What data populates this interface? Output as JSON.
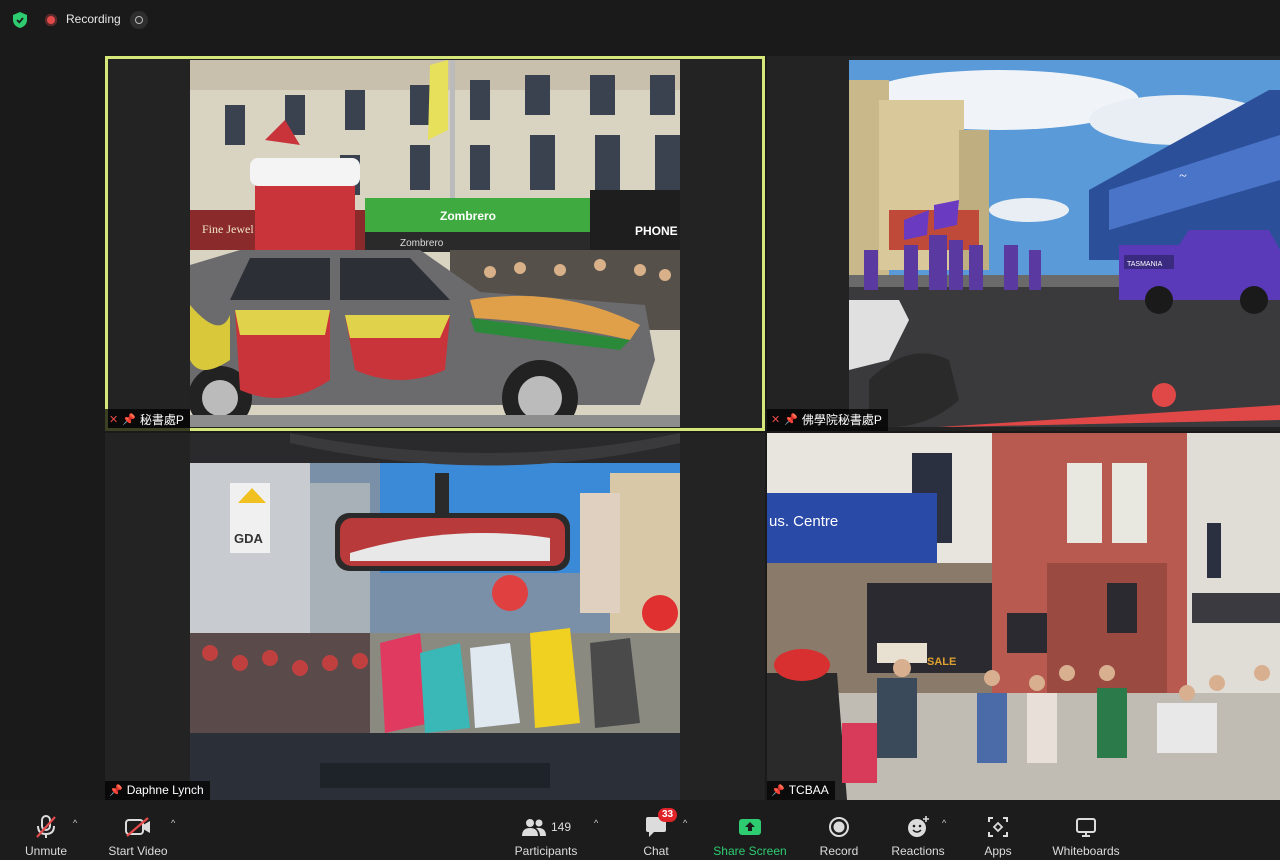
{
  "app": {
    "recording_label": "Recording",
    "accent_color": "#d6e77a",
    "icons": [
      "shield-icon",
      "record-dot-icon",
      "record-control-icon"
    ]
  },
  "tiles": [
    {
      "name": "秘書處P",
      "muted": true,
      "pinned": true,
      "active": true
    },
    {
      "name": "佛學院秘書處P",
      "muted": true,
      "pinned": true,
      "active": false
    },
    {
      "name": "Daphne Lynch",
      "muted": false,
      "pinned": true,
      "active": false
    },
    {
      "name": "TCBAA",
      "muted": false,
      "pinned": true,
      "active": false
    }
  ],
  "video_text": {
    "shop1": "Zombrero",
    "shop2": "Zombrero",
    "shop3": "PHONE",
    "shop4": "Fine Jewel",
    "store1": "GDA",
    "centre": "us. Centre",
    "sale": "SALE",
    "truck": "TASMANIA"
  },
  "toolbar": {
    "unmute": "Unmute",
    "start_video": "Start Video",
    "participants": "Participants",
    "participants_count": "149",
    "chat": "Chat",
    "chat_badge": "33",
    "share_screen": "Share Screen",
    "record": "Record",
    "reactions": "Reactions",
    "apps": "Apps",
    "whiteboards": "Whiteboards"
  }
}
